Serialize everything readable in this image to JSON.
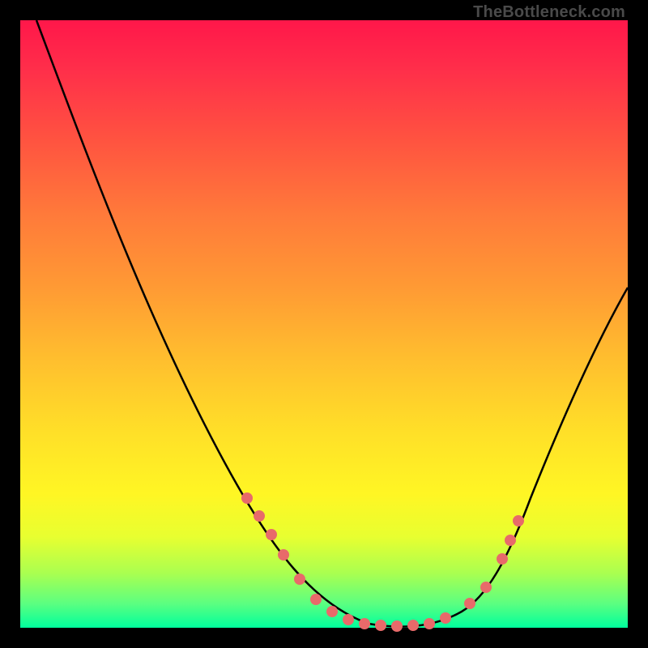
{
  "watermark": "TheBottleneck.com",
  "chart_data": {
    "type": "line",
    "title": "",
    "xlabel": "",
    "ylabel": "",
    "xlim": [
      0,
      100
    ],
    "ylim": [
      0,
      100
    ],
    "series": [
      {
        "name": "bottleneck-curve",
        "x": [
          5,
          10,
          15,
          20,
          25,
          30,
          35,
          40,
          45,
          50,
          55,
          60,
          65,
          70,
          75,
          80,
          85,
          90,
          95,
          100
        ],
        "values": [
          100,
          90,
          80,
          70,
          60,
          50,
          40,
          30,
          20,
          10,
          4,
          1,
          0,
          0,
          1,
          5,
          15,
          28,
          42,
          56
        ]
      }
    ],
    "markers": {
      "name": "highlighted-points",
      "x": [
        40,
        42,
        45,
        48,
        52,
        55,
        58,
        60,
        62,
        64,
        66,
        68,
        70,
        72,
        75,
        77,
        79
      ],
      "values": [
        30,
        25,
        20,
        15,
        8,
        4,
        2,
        1,
        0,
        0,
        0,
        0,
        0,
        1,
        2,
        6,
        12
      ]
    },
    "gradient_stops": [
      {
        "offset": 0,
        "color": "#ff174a"
      },
      {
        "offset": 50,
        "color": "#ffbf2e"
      },
      {
        "offset": 80,
        "color": "#fff624"
      },
      {
        "offset": 100,
        "color": "#00ff9d"
      }
    ]
  }
}
